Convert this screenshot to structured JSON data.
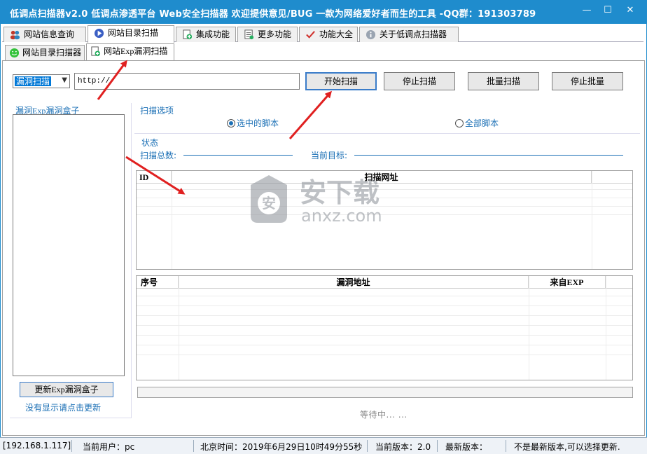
{
  "window": {
    "title": "低调点扫描器v2.0 低调点渗透平台 Web安全扫描器 欢迎提供意见/BUG 一款为网络爱好者而生的工具 -QQ群：191303789",
    "minimize_glyph": "—",
    "maximize_glyph": "☐",
    "close_glyph": "✕"
  },
  "main_tabs": [
    {
      "label": "网站信息查询",
      "icon": "users-icon"
    },
    {
      "label": "网站目录扫描",
      "icon": "play-icon"
    },
    {
      "label": "集成功能",
      "icon": "plus-doc-icon"
    },
    {
      "label": "更多功能",
      "icon": "list-icon"
    },
    {
      "label": "功能大全",
      "icon": "check-icon"
    },
    {
      "label": "关于低调点扫描器",
      "icon": "info-icon"
    }
  ],
  "sub_tabs": [
    {
      "label": "网站目录扫描器",
      "icon": "smiley-icon"
    },
    {
      "label": "网站Exp漏洞扫描",
      "icon": "plus-doc-icon"
    }
  ],
  "toolbar": {
    "mode_select": "漏洞扫描",
    "url_value": "http://",
    "start_button": "开始扫描",
    "stop_button": "停止扫描",
    "batch_button": "批量扫描",
    "stop_batch_button": "停止批量"
  },
  "left_panel": {
    "title": "漏洞Exp漏洞盒子",
    "update_button": "更新Exp漏洞盒子",
    "hint": "没有显示请点击更新"
  },
  "options": {
    "label": "扫描选项",
    "radio_selected": "选中的脚本",
    "radio_all": "全部脚本",
    "selected_checked": true
  },
  "status": {
    "label": "状态",
    "total_label": "扫描总数:",
    "target_label": "当前目标:"
  },
  "url_grid": {
    "columns": [
      "ID",
      "扫描网址"
    ]
  },
  "vuln_grid": {
    "columns": [
      "序号",
      "漏洞地址",
      "来自EXP"
    ]
  },
  "waiting_text": "等待中... ...",
  "watermark": {
    "glyph": "安",
    "text_cn": "安下载",
    "text_en": "anxz.com"
  },
  "statusbar": {
    "ip": "[192.168.1.117]",
    "user": "当前用户：pc",
    "time": "北京时间：2019年6月29日10时49分55秒",
    "version": "当前版本：2.0",
    "latest": "最新版本：",
    "notice": "不是最新版本,可以选择更新."
  },
  "colors": {
    "titlebar": "#1f8ccd",
    "label_blue": "#1a6fb5",
    "arrow_red": "#e02020"
  }
}
